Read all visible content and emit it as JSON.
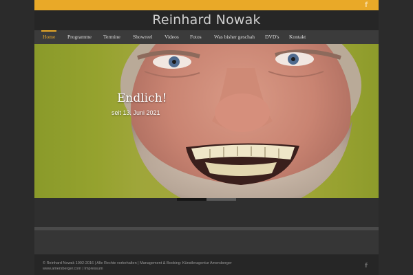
{
  "site": {
    "title": "Reinhard Nowak"
  },
  "social": {
    "icon": "facebook-icon",
    "glyph": "f"
  },
  "nav": {
    "items": [
      {
        "label": "Home",
        "active": true
      },
      {
        "label": "Programme"
      },
      {
        "label": "Termine"
      },
      {
        "label": "Showreel"
      },
      {
        "label": "Videos"
      },
      {
        "label": "Fotos"
      },
      {
        "label": "Was bisher geschah"
      },
      {
        "label": "DVD's"
      },
      {
        "label": "Kontakt"
      }
    ]
  },
  "hero": {
    "title": "Endlich!",
    "subtitle": "seit 13. Juni 2021",
    "slides_total": 2,
    "active_slide": 1
  },
  "footer": {
    "line1": "© Reinhard Nowak 1992-2016 | Alle Rechte vorbehalten | Management & Booking: Künstleragentur Amersberger",
    "line2": "www.amersberger.com | Impressum"
  },
  "colors": {
    "accent": "#e9a928",
    "background": "#262626",
    "nav_bg": "#3b3b3b"
  }
}
